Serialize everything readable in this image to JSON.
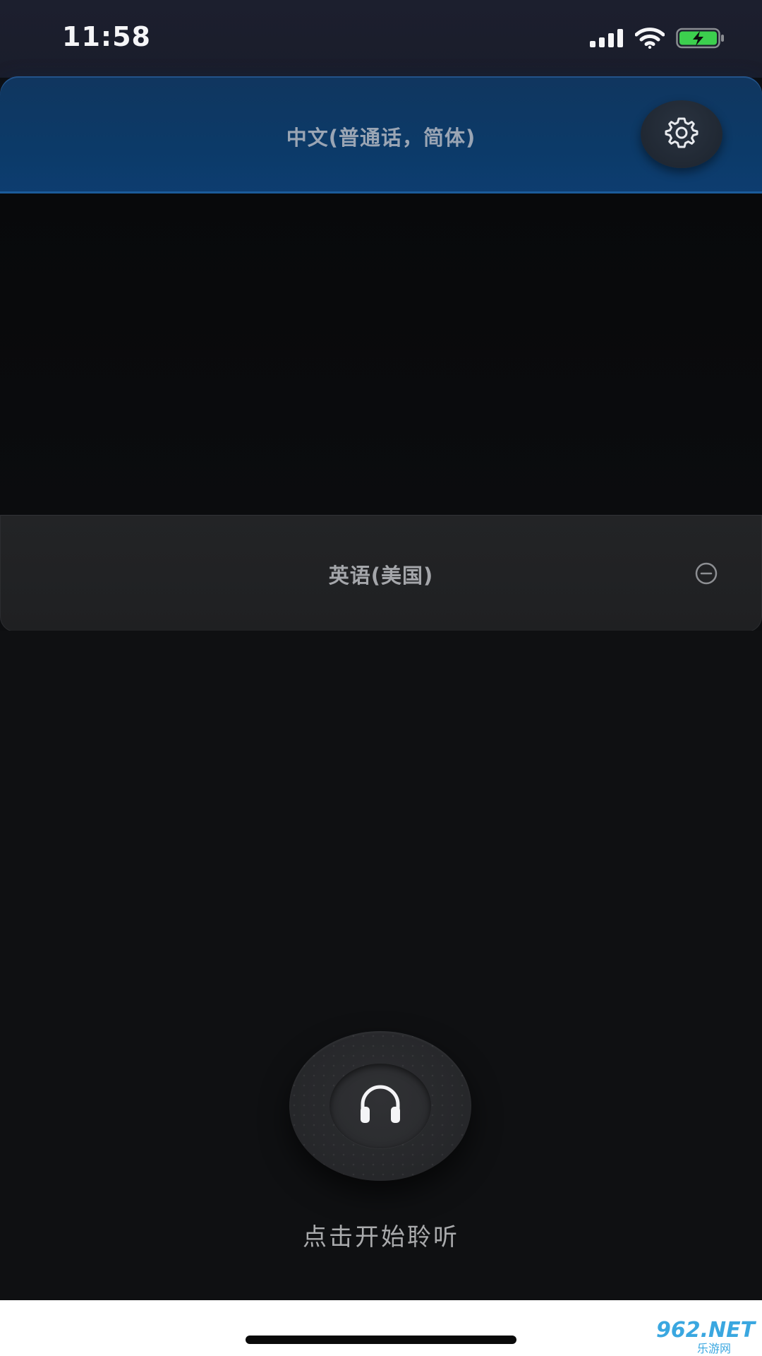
{
  "status_bar": {
    "time": "11:58",
    "icons": [
      "signal-icon",
      "wifi-icon",
      "battery-charging-icon"
    ],
    "battery_color": "#3ccf4e"
  },
  "source": {
    "language_label": "中文(普通话，简体)",
    "settings_icon": "gear-icon",
    "accent_color": "#0c3a68"
  },
  "target": {
    "language_label": "英语(美国)",
    "remove_icon": "minus-circle-icon"
  },
  "listen": {
    "icon": "headphones-icon",
    "caption": "点击开始聆听"
  },
  "watermark": {
    "brand": "962.NET",
    "sub": "乐游网"
  }
}
